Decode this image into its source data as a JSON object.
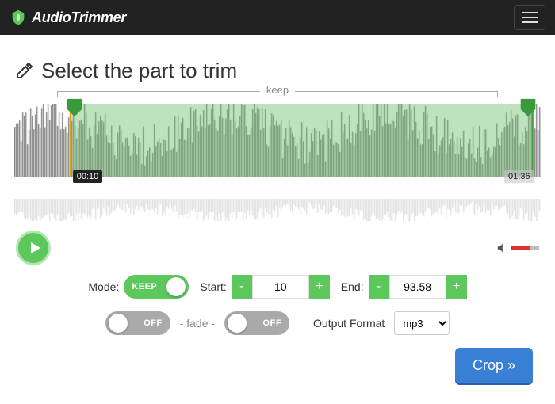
{
  "brand": "AudioTrimmer",
  "title": "Select the part to trim",
  "keep_label": "keep",
  "timeline": {
    "start_label": "00:10",
    "end_label": "01:36",
    "start_pct": 10.5,
    "end_pct": 98.5
  },
  "controls": {
    "mode": {
      "label": "Mode:",
      "value": "KEEP",
      "on": true
    },
    "start": {
      "label": "Start:",
      "value": "10"
    },
    "end": {
      "label": "End:",
      "value": "93.58"
    },
    "fade_in": {
      "value": "OFF",
      "on": false
    },
    "fade_label": "- fade -",
    "fade_out": {
      "value": "OFF",
      "on": false
    },
    "output": {
      "label": "Output Format",
      "value": "mp3"
    }
  },
  "buttons": {
    "minus": "-",
    "plus": "+",
    "crop": "Crop »"
  },
  "volume_pct": 70
}
